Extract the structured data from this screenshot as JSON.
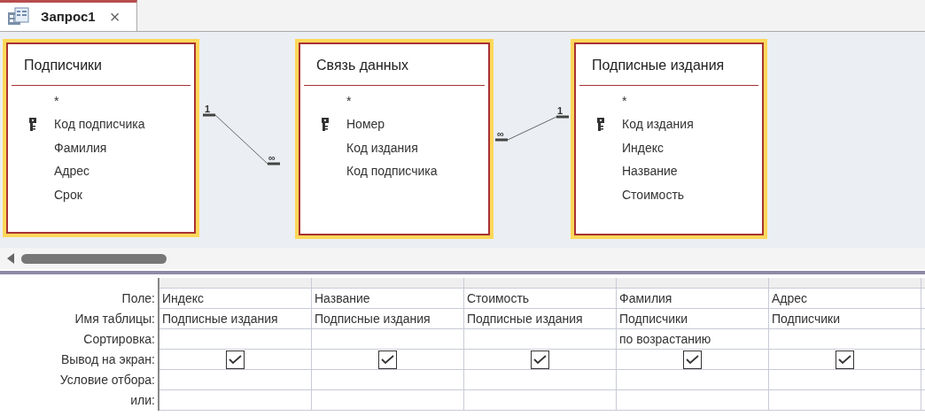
{
  "tab": {
    "title": "Запрос1",
    "close": "×",
    "selected": true
  },
  "tables": [
    {
      "title": "Подписчики",
      "fields": [
        {
          "name": "*",
          "key": false
        },
        {
          "name": "Код подписчика",
          "key": true
        },
        {
          "name": "Фамилия",
          "key": false
        },
        {
          "name": "Адрес",
          "key": false
        },
        {
          "name": "Срок",
          "key": false
        }
      ]
    },
    {
      "title": "Связь данных",
      "fields": [
        {
          "name": "*",
          "key": false
        },
        {
          "name": "Номер",
          "key": true
        },
        {
          "name": "Код издания",
          "key": false
        },
        {
          "name": "Код подписчика",
          "key": false
        }
      ]
    },
    {
      "title": "Подписные издания",
      "fields": [
        {
          "name": "*",
          "key": false
        },
        {
          "name": "Код издания",
          "key": true
        },
        {
          "name": "Индекс",
          "key": false
        },
        {
          "name": "Название",
          "key": false
        },
        {
          "name": "Стоимость",
          "key": false
        }
      ]
    }
  ],
  "relationships": [
    {
      "left_label": "1",
      "right_label": "∞"
    },
    {
      "left_label": "∞",
      "right_label": "1"
    }
  ],
  "grid": {
    "row_labels": [
      "Поле:",
      "Имя таблицы:",
      "Сортировка:",
      "Вывод на экран:",
      "Условие отбора:",
      "или:"
    ],
    "columns": [
      {
        "field": "Индекс",
        "table": "Подписные издания",
        "show": true
      },
      {
        "field": "Название",
        "table": "Подписные издания",
        "show": true
      },
      {
        "field": "Стоимость",
        "table": "Подписные издания",
        "show": true
      },
      {
        "field": "Фамилия",
        "table": "Подписчики",
        "sort": "по возрастанию",
        "show": true
      },
      {
        "field": "Адрес",
        "table": "Подписчики",
        "show": true
      }
    ]
  }
}
